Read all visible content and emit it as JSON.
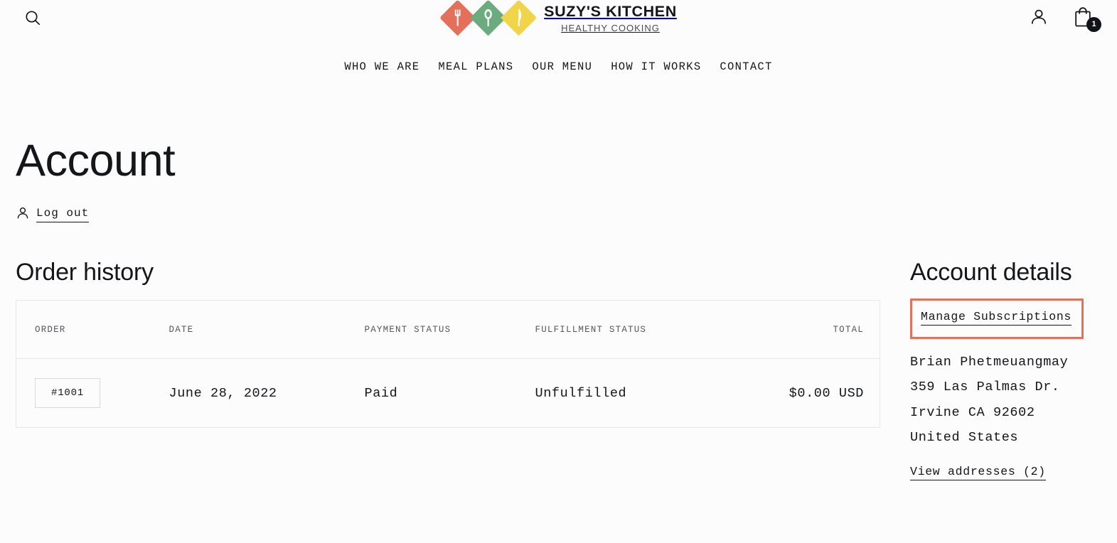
{
  "header": {
    "search_icon": "search-icon",
    "brand_name": "SUZY'S KITCHEN",
    "brand_tagline": "HEALTHY COOKING",
    "account_icon": "person-icon",
    "cart_icon": "shopping-bag-icon",
    "cart_count": "1",
    "logo_colors": [
      "#e2705a",
      "#6bab7e",
      "#f0d44a"
    ],
    "logo_glyphs": [
      "fork-icon",
      "spoon-icon",
      "knife-icon"
    ]
  },
  "nav": {
    "items": [
      {
        "label": "WHO WE ARE"
      },
      {
        "label": "MEAL PLANS"
      },
      {
        "label": "OUR MENU"
      },
      {
        "label": "HOW IT WORKS"
      },
      {
        "label": "CONTACT"
      }
    ]
  },
  "main": {
    "page_title": "Account",
    "logout_label": "Log out",
    "logout_icon": "person-icon",
    "order_history_title": "Order history",
    "table": {
      "columns": [
        "ORDER",
        "DATE",
        "PAYMENT STATUS",
        "FULFILLMENT STATUS",
        "TOTAL"
      ],
      "rows": [
        {
          "order": "#1001",
          "date": "June 28, 2022",
          "payment_status": "Paid",
          "fulfillment_status": "Unfulfilled",
          "total": "$0.00 USD"
        }
      ]
    }
  },
  "account_details": {
    "title": "Account details",
    "manage_subscriptions_label": "Manage Subscriptions",
    "highlight_color": "#e2725b",
    "address": {
      "name": "Brian Phetmeuangmay",
      "street": "359 Las Palmas Dr.",
      "city_state_zip": "Irvine CA 92602",
      "country": "United States"
    },
    "view_addresses_label": "View addresses (2)"
  }
}
